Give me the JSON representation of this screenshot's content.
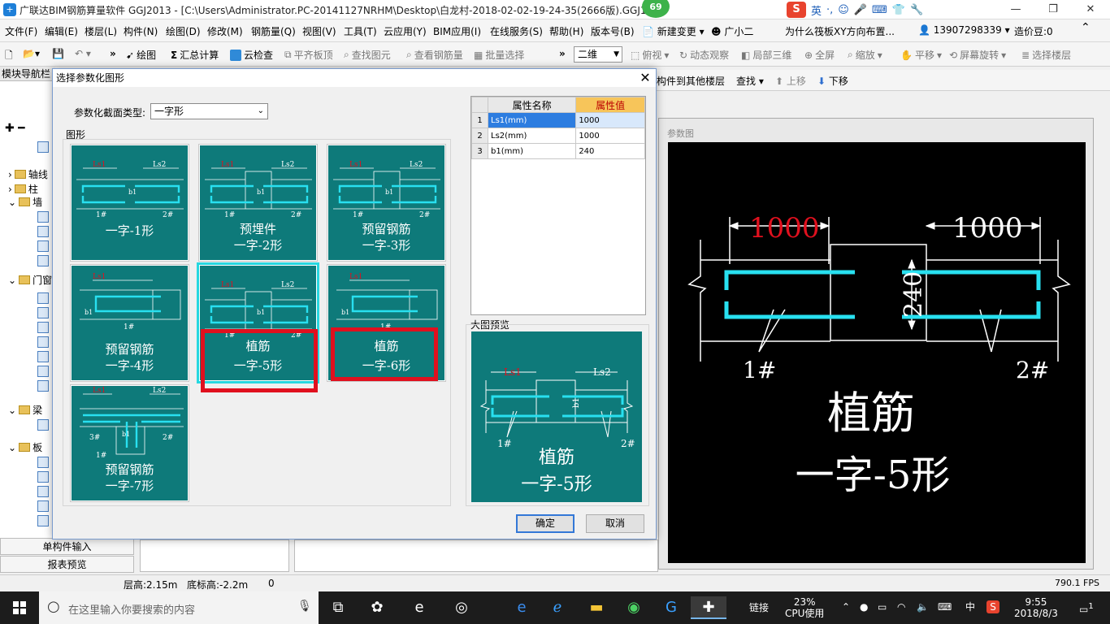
{
  "titlebar": {
    "app_icon_glyph": "+",
    "title": "广联达BIM钢筋算量软件 GGJ2013 - [C:\\Users\\Administrator.PC-20141127NRHM\\Desktop\\白龙村-2018-02-02-19-24-35(2666版).GGJ12",
    "badge": "69",
    "ime_logo": "S",
    "ime_lang": "英",
    "min": "—",
    "restore": "❐",
    "close": "✕"
  },
  "menubar": {
    "items": [
      "文件(F)",
      "编辑(E)",
      "楼层(L)",
      "构件(N)",
      "绘图(D)",
      "修改(M)",
      "钢筋量(Q)",
      "视图(V)",
      "工具(T)",
      "云应用(Y)",
      "BIM应用(I)",
      "在线服务(S)",
      "帮助(H)",
      "版本号(B)",
      "新建变更",
      "广小二"
    ],
    "news": "为什么筏板XY方向布置...",
    "phone": "13907298339",
    "coin": "造价豆:0"
  },
  "toolbar": {
    "draw": "绘图",
    "sum": "汇总计算",
    "cloud_check": "云检查",
    "flush_top": "平齐板顶",
    "find_elem": "查找图元",
    "view_rebar": "查看钢筋量",
    "batch_select": "批量选择",
    "view_mode": "二维",
    "top_view": "俯视",
    "dynamic": "动态观察",
    "local3d": "局部三维",
    "fullscreen": "全屏",
    "zoom": "缩放",
    "pan": "平移",
    "rotate": "屏幕旋转",
    "select_floor": "选择楼层"
  },
  "toolbar2": {
    "copy_to": "构件到其他楼层",
    "find": "查找",
    "up": "上移",
    "down": "下移"
  },
  "leftnav": {
    "title": "模块导航栏",
    "tree": [
      "轴线",
      "柱",
      "墙",
      "门窗",
      "梁",
      "板"
    ]
  },
  "bottomtabs": {
    "single_input": "单构件输入",
    "report": "报表预览"
  },
  "rightpanel": {
    "caption": "参数图",
    "canvas": {
      "ls1": "1000",
      "ls2": "1000",
      "b1": "240",
      "mark1": "1#",
      "mark2": "2#",
      "title1": "植筋",
      "title2": "一字-5形"
    }
  },
  "statusbar": {
    "floor_height": "层高:2.15m",
    "base_height": "底标高:-2.2m",
    "zero": "0",
    "fps": "790.1 FPS"
  },
  "taskbar": {
    "search_placeholder": "在这里输入你要搜索的内容",
    "network": "链接",
    "cpu_pct": "23%",
    "cpu_label": "CPU使用",
    "ime": "中",
    "time": "9:55",
    "date": "2018/8/3",
    "notif": "1"
  },
  "dialog": {
    "title": "选择参数化图形",
    "type_label": "参数化截面类型:",
    "type_value": "一字形",
    "shapes_label": "图形",
    "preview_label": "大图预览",
    "ok": "确定",
    "cancel": "取消",
    "thumbs": [
      {
        "l1": "",
        "l2": "一字-1形"
      },
      {
        "l1": "预埋件",
        "l2": "一字-2形"
      },
      {
        "l1": "预留钢筋",
        "l2": "一字-3形"
      },
      {
        "l1": "预留钢筋",
        "l2": "一字-4形"
      },
      {
        "l1": "植筋",
        "l2": "一字-5形"
      },
      {
        "l1": "植筋",
        "l2": "一字-6形"
      },
      {
        "l1": "预留钢筋",
        "l2": "一字-7形"
      }
    ],
    "preview": {
      "l1": "植筋",
      "l2": "一字-5形"
    },
    "thumb_marks": {
      "ls1": "Ls1",
      "ls2": "Ls2",
      "b1": "b1",
      "m1": "1#",
      "m2": "2#",
      "m3": "3#"
    },
    "props": {
      "head_name": "属性名称",
      "head_val": "属性值",
      "rows": [
        {
          "idx": "1",
          "name": "Ls1(mm)",
          "val": "1000"
        },
        {
          "idx": "2",
          "name": "Ls2(mm)",
          "val": "1000"
        },
        {
          "idx": "3",
          "name": "b1(mm)",
          "val": "240"
        }
      ]
    }
  },
  "colors": {
    "thumb_bg": "#0e7a7a",
    "rebar": "#28e0f0",
    "highlight": "#e0101e",
    "dim_red": "#e0101e"
  }
}
